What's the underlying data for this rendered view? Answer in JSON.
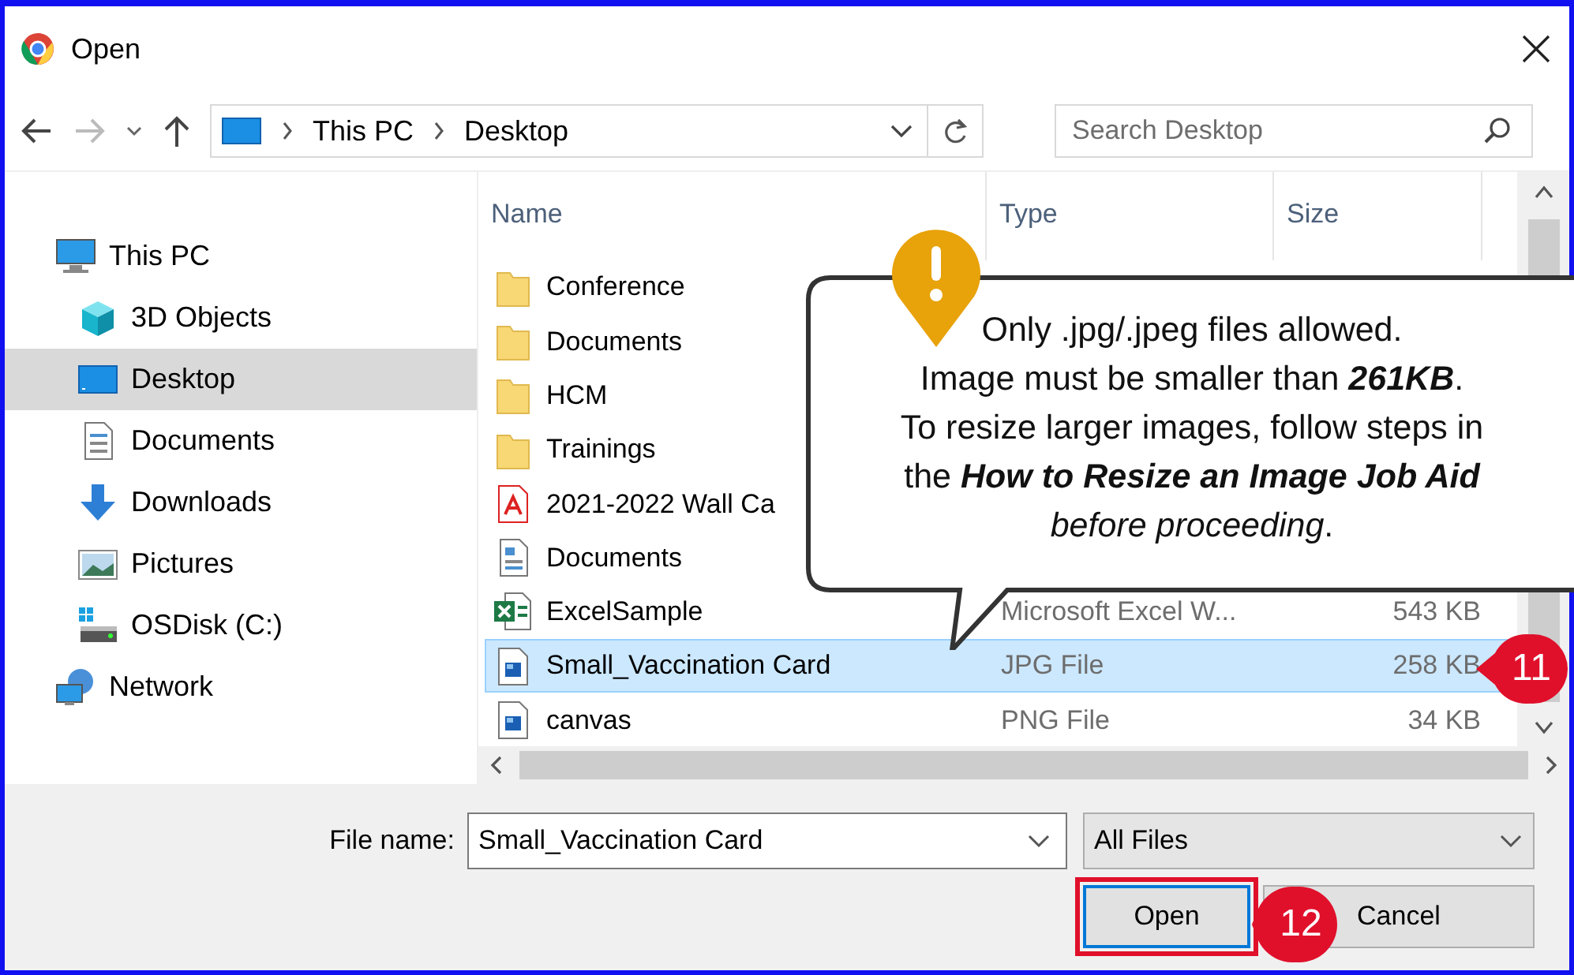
{
  "window": {
    "title": "Open"
  },
  "address": {
    "path": [
      "This PC",
      "Desktop"
    ],
    "search_placeholder": "Search Desktop"
  },
  "nav": [
    {
      "label": "This PC",
      "kind": "pc",
      "selected": false,
      "children": [
        {
          "label": "3D Objects",
          "kind": "cube",
          "selected": false
        },
        {
          "label": "Desktop",
          "kind": "desktop",
          "selected": true
        },
        {
          "label": "Documents",
          "kind": "docs",
          "selected": false
        },
        {
          "label": "Downloads",
          "kind": "download",
          "selected": false
        },
        {
          "label": "Pictures",
          "kind": "pictures",
          "selected": false
        },
        {
          "label": "OSDisk (C:)",
          "kind": "disk",
          "selected": false
        }
      ]
    },
    {
      "label": "Network",
      "kind": "network",
      "selected": false
    }
  ],
  "columns": [
    "Name",
    "Type",
    "Size"
  ],
  "files": [
    {
      "name": "Conference",
      "kind": "folder",
      "selected": false
    },
    {
      "name": "Documents",
      "kind": "folder",
      "selected": false
    },
    {
      "name": "HCM",
      "kind": "folder",
      "selected": false
    },
    {
      "name": "Trainings",
      "kind": "folder",
      "selected": false
    },
    {
      "name": "2021-2022 Wall Ca",
      "kind": "pdf",
      "selected": false
    },
    {
      "name": "Documents",
      "kind": "doc",
      "selected": false
    },
    {
      "name": "ExcelSample",
      "kind": "excel",
      "type": "Microsoft Excel W...",
      "size": "543 KB",
      "selected": false
    },
    {
      "name": "Small_Vaccination Card",
      "kind": "image",
      "type": "JPG File",
      "size": "258 KB",
      "selected": true
    },
    {
      "name": "canvas",
      "kind": "image",
      "type": "PNG File",
      "size": "34 KB",
      "selected": false
    }
  ],
  "callout": {
    "lines": [
      "Only .jpg/.jpeg files allowed.",
      "Image must be smaller than **261KB**.",
      "To resize larger images, follow steps in",
      "the **How to Resize an Image Job Aid**",
      "*before proceeding*."
    ]
  },
  "badges": [
    "11",
    "12"
  ],
  "footer": {
    "file_name_label": "File name:",
    "file_name": "Small_Vaccination Card",
    "filter": "All Files",
    "buttons": [
      {
        "label": "Open",
        "highlighted": true
      },
      {
        "label": "Cancel",
        "highlighted": false
      }
    ]
  }
}
